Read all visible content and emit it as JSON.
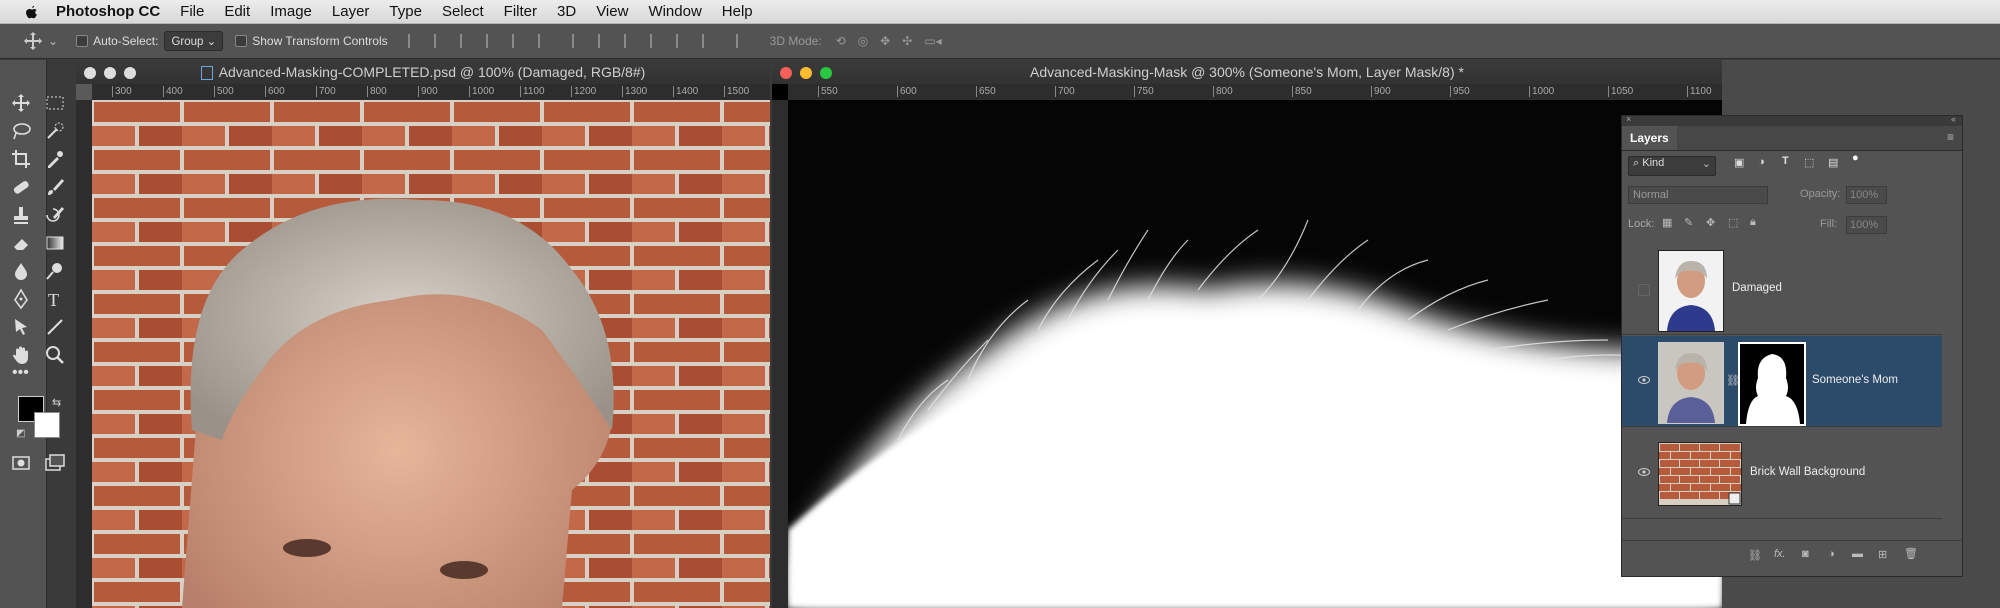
{
  "menubar": {
    "app_name": "Photoshop CC",
    "items": [
      "File",
      "Edit",
      "Image",
      "Layer",
      "Type",
      "Select",
      "Filter",
      "3D",
      "View",
      "Window",
      "Help"
    ]
  },
  "options": {
    "auto_select_label": "Auto-Select:",
    "auto_select_value": "Group",
    "transform_label": "Show Transform Controls",
    "mode_label": "3D Mode:"
  },
  "doc1": {
    "title": "Advanced-Masking-COMPLETED.psd @ 100% (Damaged, RGB/8#)",
    "ruler_ticks": [
      "300",
      "400",
      "500",
      "600",
      "700",
      "800",
      "900",
      "1000",
      "1100",
      "1200",
      "1300",
      "1400",
      "1500"
    ]
  },
  "doc2": {
    "title": "Advanced-Masking-Mask @ 300% (Someone's Mom, Layer Mask/8) *",
    "ruler_ticks": [
      "550",
      "600",
      "650",
      "700",
      "750",
      "800",
      "850",
      "900",
      "950",
      "1000",
      "1050",
      "1100"
    ]
  },
  "layers_panel": {
    "title": "Layers",
    "filter_kind": "Kind",
    "blend_mode": "Normal",
    "opacity_label": "Opacity:",
    "opacity_value": "100%",
    "lock_label": "Lock:",
    "fill_label": "Fill:",
    "fill_value": "100%",
    "layers": [
      {
        "name": "Damaged",
        "visible": false
      },
      {
        "name": "Someone's Mom",
        "visible": true
      },
      {
        "name": "Brick Wall Background",
        "visible": true
      }
    ],
    "fx_label": "fx."
  },
  "colors": {
    "accent": "#2c4a6a",
    "brick": "#b5593a"
  }
}
